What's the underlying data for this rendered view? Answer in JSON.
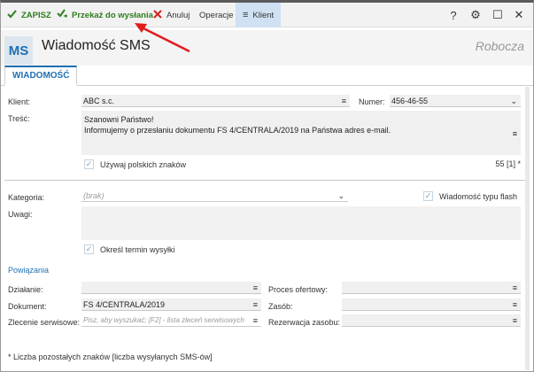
{
  "toolbar": {
    "save_label": "ZAPISZ",
    "send_label": "Przekaż do wysłania",
    "cancel_label": "Anuluj",
    "operations_label": "Operacje",
    "client_label": "Klient",
    "help_glyph": "?",
    "settings_glyph": "⚙",
    "maximize_glyph": "☐",
    "close_glyph": "✕"
  },
  "header": {
    "badge": "MS",
    "title": "Wiadomość SMS",
    "status": "Robocza"
  },
  "tabs": [
    {
      "label": "WIADOMOŚĆ"
    }
  ],
  "form": {
    "client_label": "Klient:",
    "client_value": "ABC s.c.",
    "number_label": "Numer:",
    "number_value": "456-46-55",
    "content_label": "Treść:",
    "content_line1": "Szanowni Państwo!",
    "content_line2": "Informujemy o przesłaniu dokumentu FS 4/CENTRALA/2019 na Państwa adres e-mail.",
    "polish_chars_label": "Używaj polskich znaków",
    "char_count": "55 [1] *",
    "category_label": "Kategoria:",
    "category_placeholder": "(brak)",
    "flash_label": "Wiadomość typu flash",
    "notes_label": "Uwagi:",
    "schedule_label": "Określ termin wysyłki"
  },
  "links": {
    "section_title": "Powiązania",
    "action_label": "Działanie:",
    "action_value": "",
    "document_label": "Dokument:",
    "document_value": "FS 4/CENTRALA/2019",
    "service_order_label": "Zlecenie serwisowe:",
    "service_order_placeholder": "Pisz, aby wyszukać; [F2] - lista zleceń serwisowych",
    "offer_label": "Proces ofertowy:",
    "resource_label": "Zasób:",
    "reservation_label": "Rezerwacja zasobu:"
  },
  "footnote": "* Liczba pozostałych znaków [liczba wysyłanych SMS-ów]",
  "colors": {
    "accent": "#1f6fb2",
    "save_green": "#2e7d1f",
    "cancel_red": "#d32020",
    "annotation_arrow": "#e21b1b"
  }
}
